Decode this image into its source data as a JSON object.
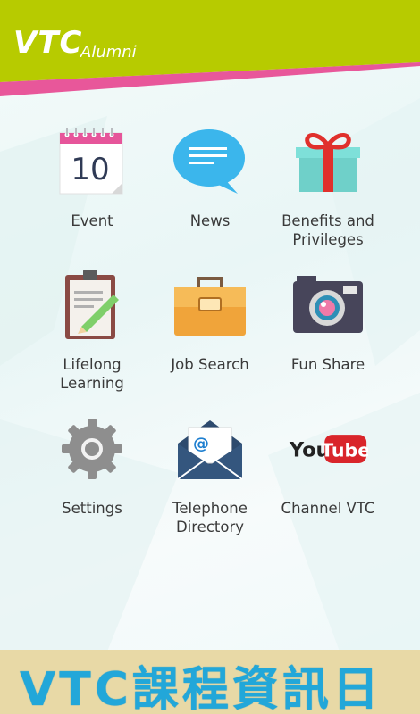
{
  "header": {
    "logo_text": "VTC",
    "logo_sub": "Alumni",
    "bar_color": "#b7cb00",
    "stripe_color": "#e8579a"
  },
  "menu": [
    {
      "label": "Event",
      "icon": "calendar-icon",
      "date": "10"
    },
    {
      "label": "News",
      "icon": "speech-bubble-icon"
    },
    {
      "label": "Benefits and\nPrivileges",
      "icon": "gift-icon"
    },
    {
      "label": "Lifelong\nLearning",
      "icon": "clipboard-icon"
    },
    {
      "label": "Job Search",
      "icon": "briefcase-icon"
    },
    {
      "label": "Fun Share",
      "icon": "camera-icon"
    },
    {
      "label": "Settings",
      "icon": "gear-icon"
    },
    {
      "label": "Telephone\nDirectory",
      "icon": "envelope-icon",
      "symbol": "@"
    },
    {
      "label": "Channel VTC",
      "icon": "youtube-icon",
      "you": "You",
      "tube": "Tube"
    }
  ],
  "banner": {
    "text": "VTC課程資訊日"
  }
}
